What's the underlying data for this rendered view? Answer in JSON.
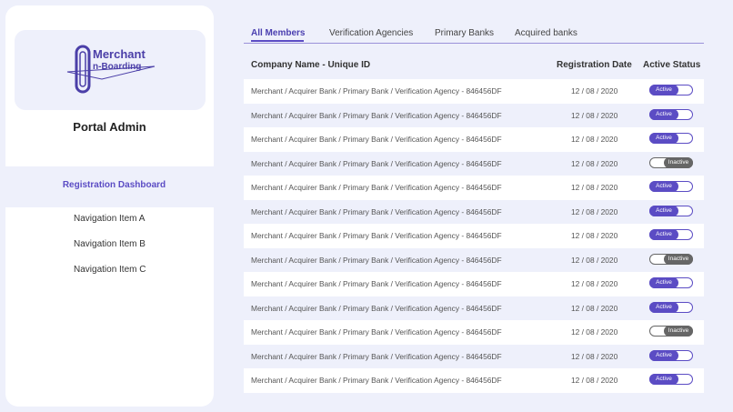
{
  "sidebar": {
    "logo_line1": "Merchant",
    "logo_line2": "n-Boarding",
    "portal_title": "Portal Admin",
    "active_item": "Registration Dashboard",
    "items": [
      "Navigation Item A",
      "Navigation Item B",
      "Navigation Item C"
    ]
  },
  "tabs": [
    "All Members",
    "Verification Agencies",
    "Primary Banks",
    "Acquired banks"
  ],
  "table": {
    "headers": [
      "Company Name - Unique ID",
      "Registration Date",
      "Active Status"
    ],
    "rows": [
      {
        "name": "Merchant / Acquirer Bank / Primary Bank / Verification Agency - 846456DF",
        "date": "12 / 08 / 2020",
        "status": "Active"
      },
      {
        "name": "Merchant / Acquirer Bank / Primary Bank / Verification Agency - 846456DF",
        "date": "12 / 08 / 2020",
        "status": "Active"
      },
      {
        "name": "Merchant / Acquirer Bank / Primary Bank / Verification Agency - 846456DF",
        "date": "12 / 08 / 2020",
        "status": "Active"
      },
      {
        "name": "Merchant / Acquirer Bank / Primary Bank / Verification Agency - 846456DF",
        "date": "12 / 08 / 2020",
        "status": "Inactive"
      },
      {
        "name": "Merchant / Acquirer Bank / Primary Bank / Verification Agency - 846456DF",
        "date": "12 / 08 / 2020",
        "status": "Active"
      },
      {
        "name": "Merchant / Acquirer Bank / Primary Bank / Verification Agency - 846456DF",
        "date": "12 / 08 / 2020",
        "status": "Active"
      },
      {
        "name": "Merchant / Acquirer Bank / Primary Bank / Verification Agency - 846456DF",
        "date": "12 / 08 / 2020",
        "status": "Active"
      },
      {
        "name": "Merchant / Acquirer Bank / Primary Bank / Verification Agency - 846456DF",
        "date": "12 / 08 / 2020",
        "status": "Inactive"
      },
      {
        "name": "Merchant / Acquirer Bank / Primary Bank / Verification Agency - 846456DF",
        "date": "12 / 08 / 2020",
        "status": "Active"
      },
      {
        "name": "Merchant / Acquirer Bank / Primary Bank / Verification Agency - 846456DF",
        "date": "12 / 08 / 2020",
        "status": "Active"
      },
      {
        "name": "Merchant / Acquirer Bank / Primary Bank / Verification Agency - 846456DF",
        "date": "12 / 08 / 2020",
        "status": "Inactive"
      },
      {
        "name": "Merchant / Acquirer Bank / Primary Bank / Verification Agency - 846456DF",
        "date": "12 / 08 / 2020",
        "status": "Active"
      },
      {
        "name": "Merchant / Acquirer Bank / Primary Bank / Verification Agency - 846456DF",
        "date": "12 / 08 / 2020",
        "status": "Active"
      }
    ]
  },
  "colors": {
    "accent": "#5b4cc4",
    "background": "#eef0fb",
    "inactive": "#666666"
  }
}
